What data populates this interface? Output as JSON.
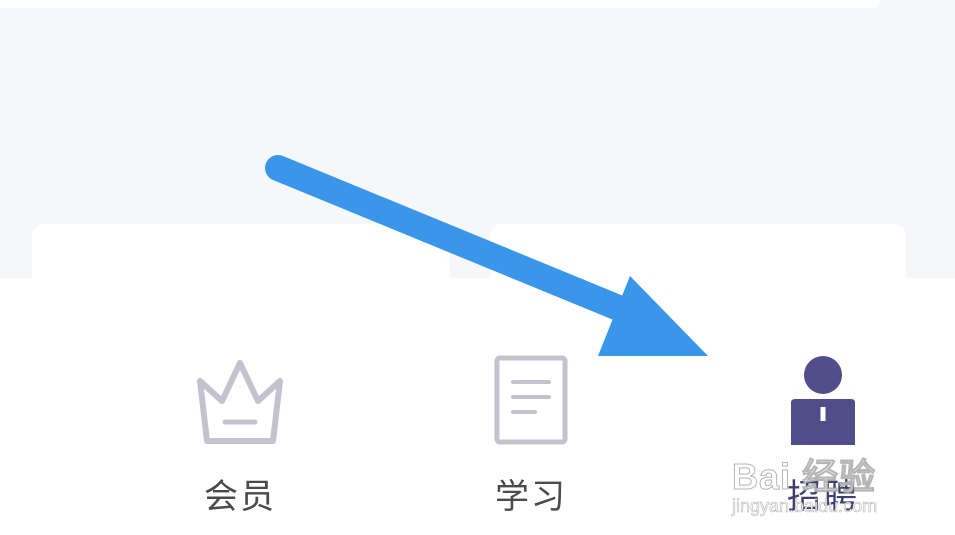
{
  "tabbar": {
    "tabs": [
      {
        "label": "会员",
        "icon": "crown-icon",
        "active": false
      },
      {
        "label": "学习",
        "icon": "document-icon",
        "active": false
      },
      {
        "label": "招聘",
        "icon": "recruiter-icon",
        "active": true
      }
    ]
  },
  "watermark": {
    "main": "Bai 经验",
    "sub": "jingyan.baidu.com"
  },
  "colors": {
    "background": "#f5f7fb",
    "inactive_icon": "#c3c3cf",
    "active_icon": "#4f4e8b",
    "arrow": "#3a96e8",
    "label": "#4a4a4a"
  }
}
